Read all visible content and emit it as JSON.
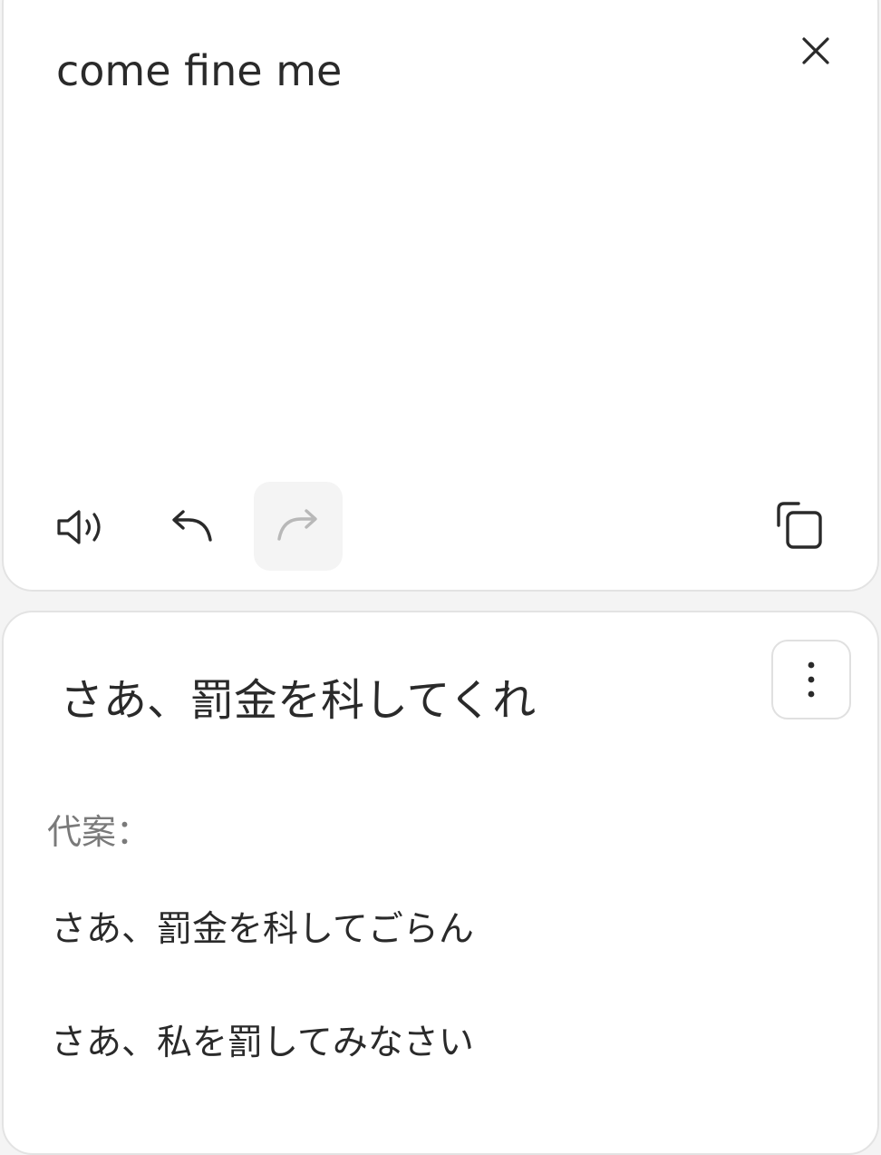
{
  "source": {
    "text": "come fine me"
  },
  "translation": {
    "text": "さあ、罰金を科してくれ",
    "alternatives_label": "代案：",
    "alternatives": [
      "さあ、罰金を科してごらん",
      "さあ、私を罰してみなさい"
    ]
  },
  "icons": {
    "close": "close-icon",
    "speak": "speaker-icon",
    "undo": "undo-icon",
    "redo": "redo-icon",
    "copy": "copy-icon",
    "more": "more-vertical-icon"
  },
  "colors": {
    "text": "#2a2a2a",
    "muted_text": "#7a7a7a",
    "disabled_icon": "#b8b8b8",
    "card_border": "#e3e3e3",
    "page_background": "#f4f4f4"
  }
}
